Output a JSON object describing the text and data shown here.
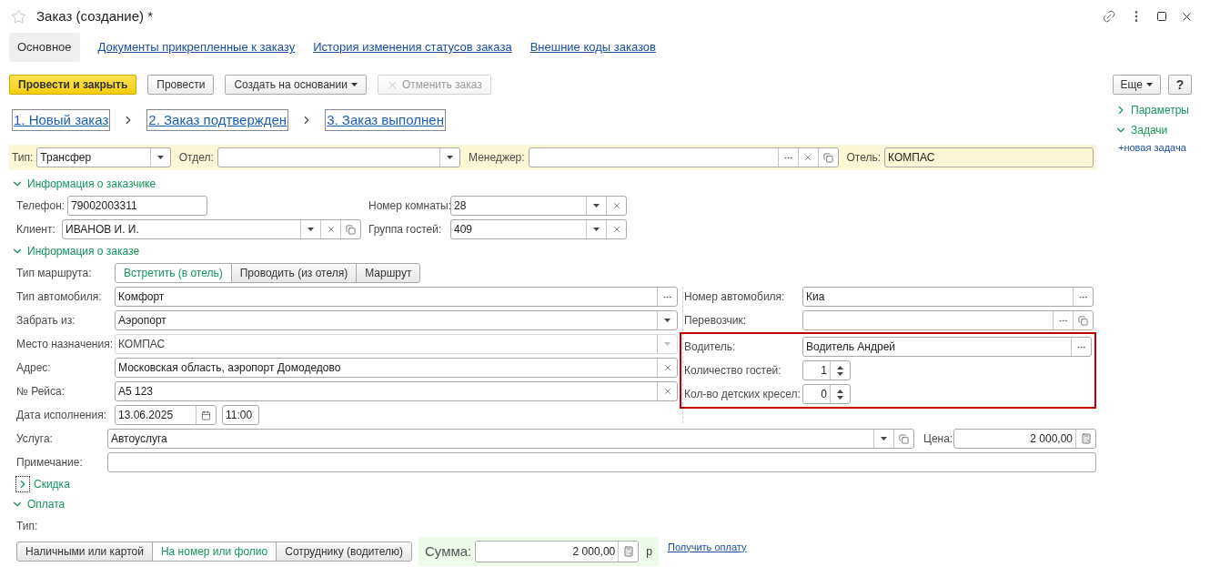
{
  "window": {
    "title": "Заказ (создание) *"
  },
  "tabs": [
    {
      "label": "Основное",
      "selected": true
    },
    {
      "label": "Документы прикрепленные к заказу",
      "selected": false
    },
    {
      "label": "История изменения статусов заказа",
      "selected": false
    },
    {
      "label": "Внешние коды заказов",
      "selected": false
    }
  ],
  "toolbar": [
    {
      "label": "Провести и закрыть",
      "kind": "primary",
      "disabled": false
    },
    {
      "label": "Провести",
      "kind": "plain",
      "disabled": false
    },
    {
      "label": "Создать на основании",
      "kind": "menu",
      "disabled": false
    },
    {
      "label": "Отменить заказ",
      "kind": "cancel",
      "disabled": true
    }
  ],
  "steps": [
    "1. Новый заказ",
    "2. Заказ подтвержден",
    "3. Заказ выполнен"
  ],
  "header_fields": [
    {
      "label": "Тип:",
      "value": "Трансфер",
      "buttons": [
        {
          "kind": "dropdown"
        }
      ]
    },
    {
      "label": "Отдел:",
      "buttons": [
        {
          "kind": "dropdown"
        }
      ]
    },
    {
      "label": "Менеджер:",
      "buttons": [
        {
          "kind": "select"
        },
        {
          "kind": "clear"
        },
        {
          "kind": "open"
        }
      ]
    },
    {
      "label": "Отель:",
      "value": "КОМПАС",
      "readonly": true
    }
  ],
  "customer": {
    "title": "Информация о заказчике",
    "expanded": true,
    "fields": [
      {
        "label": "Телефон:",
        "value": "79002003311"
      },
      {
        "label": "Номер комнаты:",
        "value": "28",
        "buttons": [
          {
            "kind": "dropdown"
          },
          {
            "kind": "clear"
          }
        ]
      },
      {
        "label": "Клиент:",
        "value": "ИВАНОВ И. И.",
        "buttons": [
          {
            "kind": "dropdown"
          },
          {
            "kind": "clear"
          },
          {
            "kind": "open"
          }
        ]
      },
      {
        "label": "Группа гостей:",
        "value": "409",
        "buttons": [
          {
            "kind": "dropdown"
          },
          {
            "kind": "clear"
          }
        ]
      }
    ]
  },
  "order": {
    "title": "Информация о заказе",
    "expanded": true,
    "route_type": {
      "label": "Тип маршрута:",
      "options": [
        {
          "label": "Встретить (в отель)",
          "selected": true
        },
        {
          "label": "Проводить (из отеля)",
          "selected": false
        },
        {
          "label": "Маршрут",
          "selected": false
        }
      ]
    },
    "left_fields": [
      {
        "label": "Тип автомобиля:",
        "value": "Комфорт",
        "buttons": [
          {
            "kind": "select"
          }
        ]
      },
      {
        "label": "Забрать из:",
        "value": "Аэропорт",
        "buttons": [
          {
            "kind": "dropdown"
          }
        ]
      },
      {
        "label": "Место назначения:",
        "value": "КОМПАС",
        "buttons": [
          {
            "kind": "dropdown"
          }
        ],
        "disabled": true
      },
      {
        "label": "Адрес:",
        "value": "Московская область, аэропорт Домодедово",
        "buttons": [
          {
            "kind": "clear"
          }
        ]
      },
      {
        "label": "№ Рейса:",
        "value": "А5 123",
        "buttons": [
          {
            "kind": "clear"
          }
        ]
      }
    ],
    "date": {
      "label": "Дата исполнения:",
      "date": "13.06.2025",
      "time": "11:00"
    },
    "right_fields": [
      {
        "label": "Номер автомобиля:",
        "value": "Киа",
        "buttons": [
          {
            "kind": "select"
          }
        ]
      },
      {
        "label": "Перевозчик:",
        "buttons": [
          {
            "kind": "select"
          },
          {
            "kind": "open"
          }
        ]
      }
    ],
    "driver_group": {
      "highlighted": true,
      "fields": [
        {
          "label": "Водитель:",
          "value": "Водитель Андрей",
          "buttons": [
            {
              "kind": "select"
            }
          ]
        },
        {
          "label": "Количество гостей:",
          "value": "1",
          "buttons": [
            {
              "kind": "spin"
            }
          ]
        },
        {
          "label": "Кол-во детских кресел:",
          "value": "0",
          "buttons": [
            {
              "kind": "spin"
            }
          ]
        }
      ]
    },
    "service": {
      "label": "Услуга:",
      "value": "Автоуслуга",
      "buttons": [
        {
          "kind": "dropdown"
        },
        {
          "kind": "open"
        }
      ]
    },
    "price": {
      "label": "Цена:",
      "value": "2 000,00",
      "buttons": [
        {
          "kind": "calculator"
        }
      ]
    },
    "note": {
      "label": "Примечание:"
    }
  },
  "discount": {
    "title": "Скидка",
    "expanded": false,
    "focused": true
  },
  "payment": {
    "title": "Оплата",
    "expanded": true,
    "type_label": "Тип:",
    "options": [
      {
        "label": "Наличными или картой",
        "selected": false
      },
      {
        "label": "На номер или фолио",
        "selected": true
      },
      {
        "label": "Сотруднику (водителю)",
        "selected": false
      }
    ],
    "sum_label": "Сумма:",
    "sum": "2 000,00",
    "currency": "р",
    "pay_link": "Получить оплату"
  },
  "sidebar": {
    "more": "Еще",
    "help": "?",
    "groups": [
      {
        "title": "Параметры",
        "expanded": false
      },
      {
        "title": "Задачи",
        "expanded": true
      }
    ],
    "new_task": "+новая задача"
  }
}
